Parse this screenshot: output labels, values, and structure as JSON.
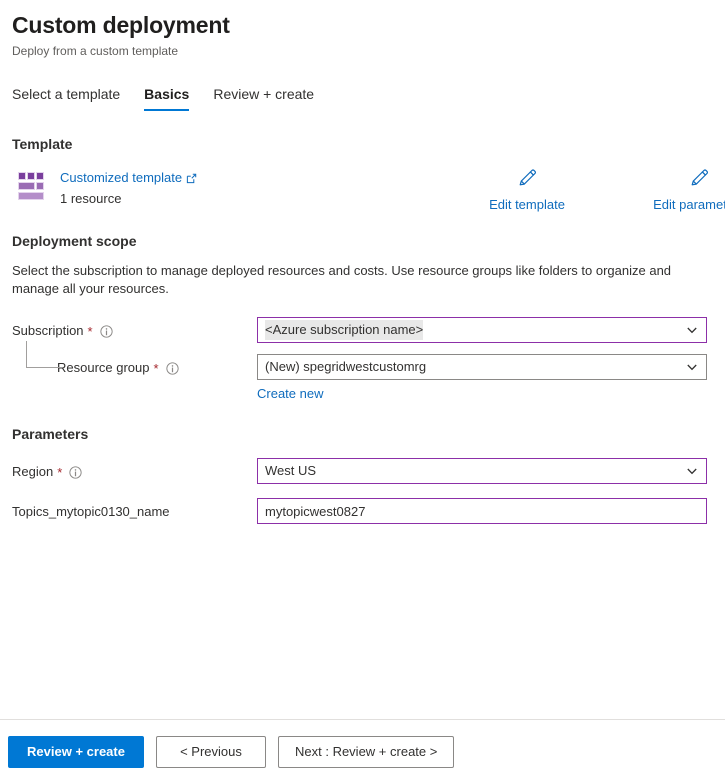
{
  "header": {
    "title": "Custom deployment",
    "subtitle": "Deploy from a custom template"
  },
  "tabs": [
    {
      "label": "Select a template",
      "active": false
    },
    {
      "label": "Basics",
      "active": true
    },
    {
      "label": "Review + create",
      "active": false
    }
  ],
  "template_section": {
    "heading": "Template",
    "icon": "template-blocks-icon",
    "link_label": "Customized template",
    "external_icon": "external-link-icon",
    "resource_count": "1 resource",
    "actions": [
      {
        "label": "Edit template",
        "icon": "pencil-icon"
      },
      {
        "label": "Edit parameters",
        "icon": "pencil-icon"
      }
    ]
  },
  "deployment_scope": {
    "heading": "Deployment scope",
    "description": "Select the subscription to manage deployed resources and costs. Use resource groups like folders to organize and manage all your resources.",
    "subscription": {
      "label": "Subscription",
      "required": "*",
      "info_icon": "info-icon",
      "value": "<Azure subscription name>",
      "chevron_icon": "chevron-down-icon",
      "focused": true
    },
    "resource_group": {
      "label": "Resource group",
      "required": "*",
      "info_icon": "info-icon",
      "value": "(New) spegridwestcustomrg",
      "chevron_icon": "chevron-down-icon",
      "create_new_label": "Create new",
      "focused": false
    }
  },
  "parameters": {
    "heading": "Parameters",
    "region": {
      "label": "Region",
      "required": "*",
      "info_icon": "info-icon",
      "value": "West US",
      "chevron_icon": "chevron-down-icon",
      "focused": true
    },
    "topic_name": {
      "label": "Topics_mytopic0130_name",
      "value": "mytopicwest0827",
      "placeholder": "",
      "focused": true
    }
  },
  "footer": {
    "review_create": "Review + create",
    "previous": "< Previous",
    "next": "Next : Review + create >"
  },
  "colors": {
    "accent": "#0078d4",
    "link": "#0f6cbd",
    "focus_border": "#8c2fa8",
    "required": "#a4262c",
    "icon_purple_dark": "#7a3e9d",
    "icon_purple_mid": "#9a6cb4",
    "icon_purple_light": "#b48ec9"
  }
}
